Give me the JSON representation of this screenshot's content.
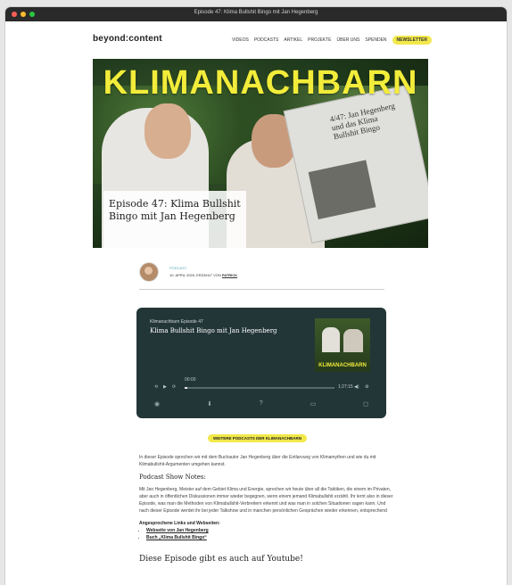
{
  "window": {
    "title": "Episode 47: Klima Bullshit Bingo mit Jan Hegenberg"
  },
  "nav": {
    "logo": "beyond:content",
    "items": [
      "VIDEOS",
      "PODCASTS",
      "ARTIKEL",
      "PROJEKTE",
      "ÜBER UNS",
      "SPENDEN"
    ],
    "newsletter": "NEWSLETTER"
  },
  "hero": {
    "banner": "KLIMANACHBARN",
    "caption": "Episode 47: Klima Bullshit Bingo mit Jan Hegenberg",
    "newspaper": "4/47: Jan Hegenberg und das Klima Bullshit Bingo"
  },
  "author": {
    "category": "PODCAST",
    "date_prefix": "10. APRIL 2025, ERZÄHLT VON",
    "name": "PATRICK"
  },
  "player": {
    "series": "Klimanachbarn Episode 47",
    "title": "Klima Bullshit Bingo mit Jan Hegenberg",
    "cover_text": "KLIMANACHBARN",
    "time_current": "00:00",
    "time_total": "1:27:15",
    "progress": 0.0
  },
  "more_button": "WEITERE PODCASTS DER KLIMANACHBARN",
  "content": {
    "intro": "In dieser Episode sprechen wir mit dem Buchautor Jan Hegenberg über die Entlarvung von Klimamythen und wie du mit Klimabullshit-Argumenten umgehen kannst.",
    "notes_heading": "Podcast Show Notes:",
    "notes_text": "Mit Jan Hegenberg, Meister auf dem Gebiet Klima und Energie, sprechen wir heute über all die Taktiken, die einem im Privaten, aber auch in öffentlichen Diskussionen immer wieder begegnen, wenn einem jemand Klimabullshit erzählt. Ihr lernt also in dieser Episode, was man die Methoden von Klimabullshit-Verbreitern erkennt und was man in solchen Situationen sagen kann. Und nach dieser Episode werdet ihr bei jeder Talkshow und in manchen persönlichen Gesprächen wieder erkennen, entsprechend",
    "links_heading": "Angesprochene Links und Webseiten:",
    "links": [
      "Webseite von Jan Hegenberg",
      "Buch „Klima Bullshit Bingo“"
    ],
    "youtube": "Diese Episode gibt es auch auf Youtube!"
  },
  "colors": {
    "accent": "#f2e84a",
    "player_bg": "#233637",
    "category": "#59a7b8"
  }
}
